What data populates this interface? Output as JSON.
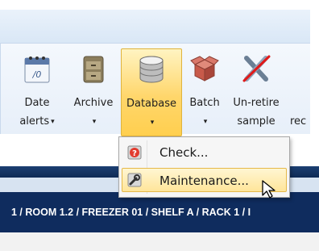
{
  "ribbon": {
    "tools": [
      {
        "id": "date-alerts",
        "label_line1": "Date",
        "label_line2": "alerts",
        "has_dropdown": true,
        "icon": "calendar-icon"
      },
      {
        "id": "archive",
        "label_line1": "Archive",
        "label_line2": "",
        "has_dropdown": true,
        "icon": "archive-cabinet-icon"
      },
      {
        "id": "database",
        "label_line1": "Database",
        "label_line2": "",
        "has_dropdown": true,
        "icon": "database-icon",
        "state": "active"
      },
      {
        "id": "batch",
        "label_line1": "Batch",
        "label_line2": "",
        "has_dropdown": true,
        "icon": "open-box-icon"
      },
      {
        "id": "unretire-sample",
        "label_line1": "Un-retire",
        "label_line2": "sample",
        "has_dropdown": false,
        "icon": "crossed-tubes-icon"
      },
      {
        "id": "partial",
        "label_line1": "",
        "label_line2": "rec",
        "has_dropdown": false,
        "icon": ""
      }
    ],
    "caret": "▾"
  },
  "database_menu": {
    "items": [
      {
        "label": "Check...",
        "icon": "database-check-icon"
      },
      {
        "label": "Maintenance...",
        "icon": "wrench-icon",
        "state": "hover"
      }
    ]
  },
  "location_bar": {
    "path": "1 / ROOM 1.2 / FREEZER 01 / SHELF A / RACK 1 / I"
  },
  "colors": {
    "ribbon_bg": "#e7eff9",
    "active_gold": "#ffd66b",
    "breadcrumb_bg": "#0f2c5e"
  }
}
